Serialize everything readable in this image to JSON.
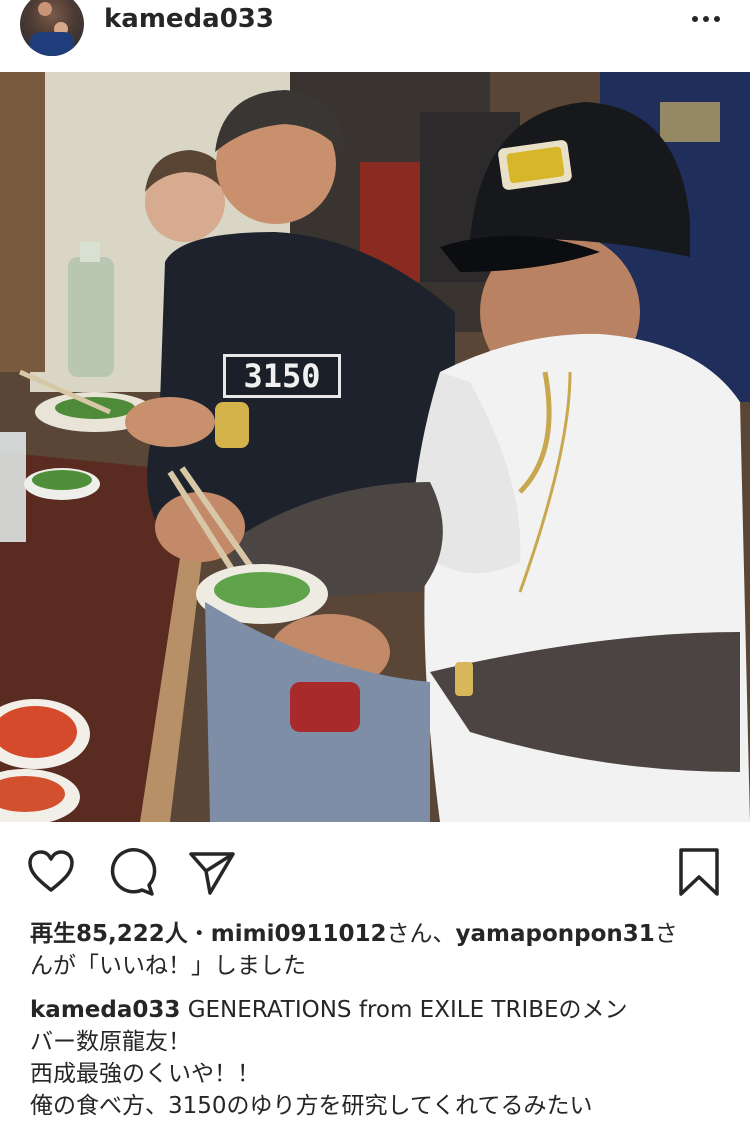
{
  "post": {
    "username": "kameda033",
    "photo_shirt_text": "3150"
  },
  "engagement": {
    "views_prefix": "再生",
    "views_count": "85,222人",
    "separator": "・",
    "liker1": "mimi0911012",
    "liker1_suffix": "さん、",
    "liker2": "yamaponpon31",
    "liker2_suffix": "さ",
    "likes_tail": "んが「いいね！」しました"
  },
  "caption": {
    "username": "kameda033",
    "line1": "GENERATIONS from EXILE TRIBEのメン",
    "line2": "バー数原龍友！",
    "line3": "西成最強のくいや！！",
    "line4": "俺の食べ方、3150のゆり方を研究してくれてるみたい"
  },
  "icons": {
    "more": "more-options-icon",
    "like": "heart-icon",
    "comment": "comment-icon",
    "share": "share-icon",
    "save": "bookmark-icon"
  }
}
